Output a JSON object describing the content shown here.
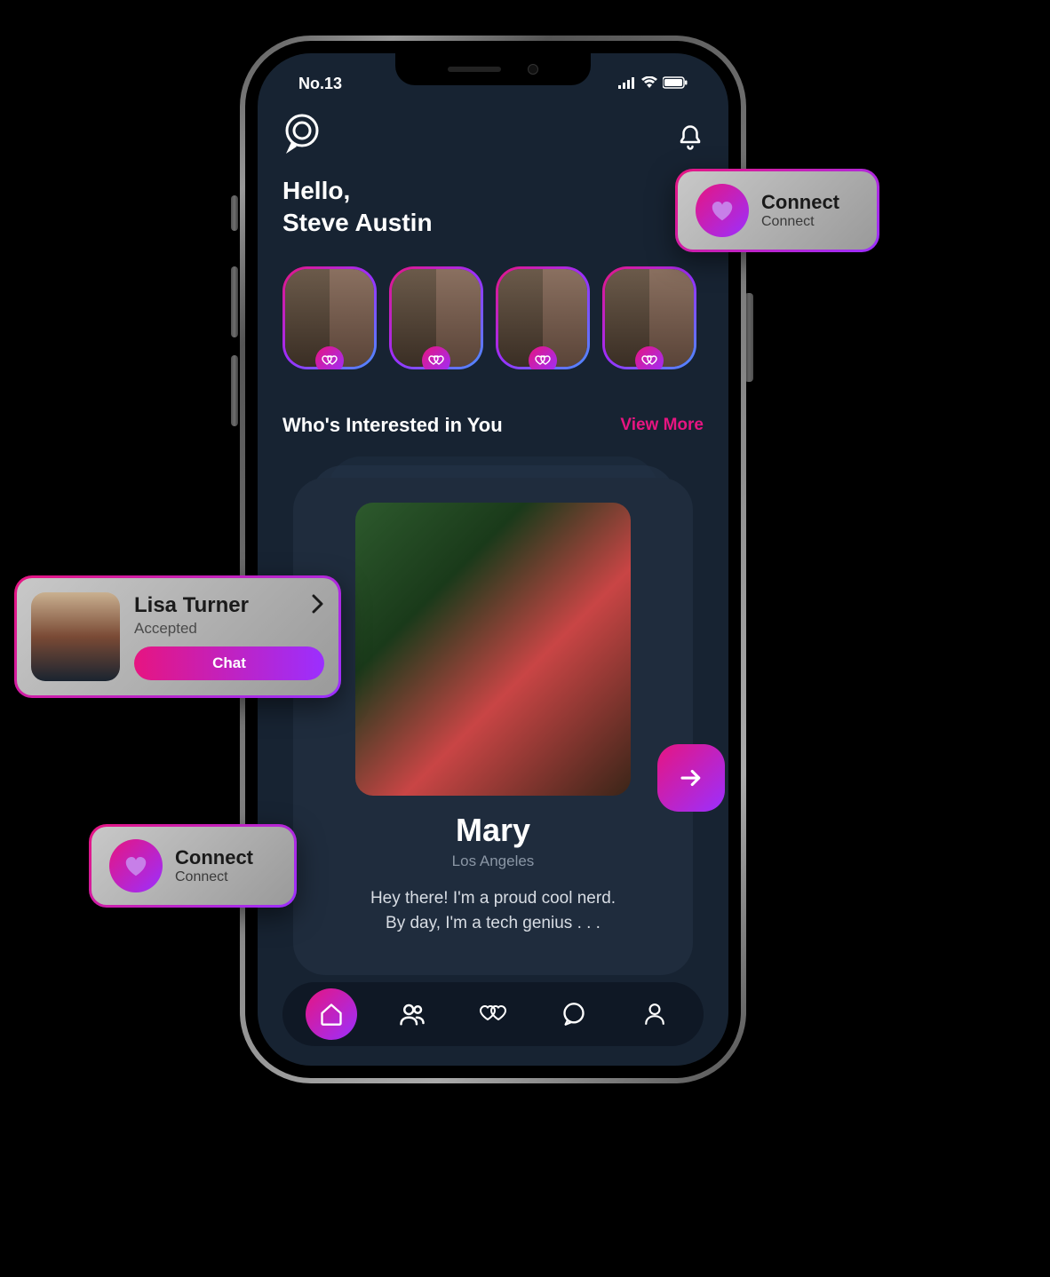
{
  "status": {
    "left": "No.13"
  },
  "greeting": {
    "hello": "Hello,",
    "name": "Steve Austin"
  },
  "section": {
    "title": "Who's Interested in You",
    "more": "View More"
  },
  "profile": {
    "name": "Mary",
    "location": "Los Angeles",
    "bio1": "Hey there! I'm a proud cool nerd.",
    "bio2": "By day, I'm a tech genius . . ."
  },
  "popouts": {
    "connect_title": "Connect",
    "connect_sub": "Connect",
    "lisa_name": "Lisa Turner",
    "lisa_status": "Accepted",
    "chat": "Chat"
  }
}
